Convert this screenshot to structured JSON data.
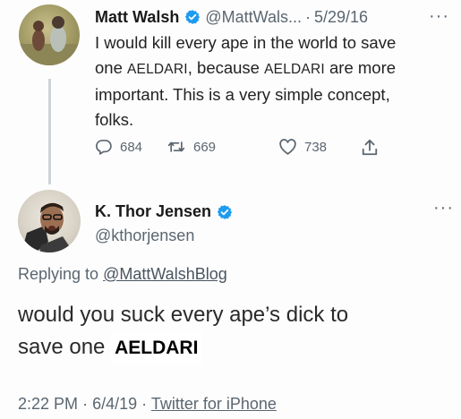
{
  "tweet1": {
    "author_name": "Matt Walsh",
    "handle": "@MattWals...",
    "separator": "·",
    "date": "5/29/16",
    "more": "···",
    "text_line1": "I would kill every ape in the world to save",
    "text_line2_a": "one",
    "text_line2_b": "AELDARI",
    "text_line2_c": ", because",
    "text_line2_d": "AELDARI",
    "text_line2_e": "are more",
    "text_line3": "important. This is a very simple concept,",
    "text_line4": "folks.",
    "replies": "684",
    "retweets": "669",
    "likes": "738"
  },
  "tweet2": {
    "author_name": "K. Thor Jensen",
    "handle": "@kthorjensen",
    "more": "···",
    "replying_prefix": "Replying to",
    "replying_to": "@MattWalshBlog",
    "text_line1": "would you suck every ape’s dick to",
    "text_line2_a": "save one",
    "text_line2_b": "AELDARI",
    "time": "2:22 PM",
    "separator": "·",
    "date": "6/4/19",
    "source": "Twitter for iPhone"
  },
  "colors": {
    "verified": "#1d9bf0",
    "secondary": "#5b6670",
    "text": "#222222"
  },
  "icons": [
    "reply-icon",
    "retweet-icon",
    "like-icon",
    "share-icon",
    "verified-badge-icon"
  ]
}
